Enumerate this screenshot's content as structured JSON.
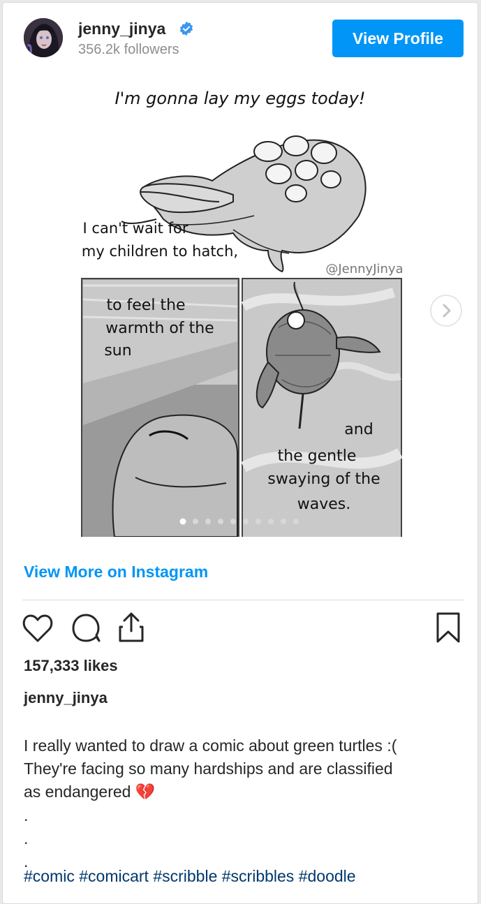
{
  "header": {
    "username": "jenny_jinya",
    "followers": "356.2k followers",
    "view_profile_label": "View Profile"
  },
  "comic": {
    "top_caption": "I'm gonna lay my eggs today!",
    "caption_line1": "I can't wait for",
    "caption_line2": "my children to hatch,",
    "watermark": "@JennyJinya",
    "panel1_line1": "to feel the",
    "panel1_line2": "warmth of the",
    "panel1_line3": "sun",
    "panel2_line1": "and",
    "panel2_line2": "the gentle",
    "panel2_line3": "swaying of the",
    "panel2_line4": "waves.",
    "carousel_index": 1,
    "carousel_total": 10
  },
  "view_more_label": "View More on Instagram",
  "actions": {
    "like_icon": "heart-icon",
    "comment_icon": "comment-icon",
    "share_icon": "share-icon",
    "save_icon": "bookmark-icon"
  },
  "likes": "157,333 likes",
  "post": {
    "author": "jenny_jinya",
    "caption_line1": "I really wanted to draw a comic about green turtles :(",
    "caption_line2": "They're facing so many hardships and are classified",
    "caption_line3": "as endangered",
    "caption_emoji": "💔",
    "dot": ".",
    "hashtags": "#comic #comicart #scribble #scribbles #doodle"
  },
  "colors": {
    "accent": "#0095f6",
    "hashtag": "#00376b",
    "muted": "#8e8e8e"
  }
}
